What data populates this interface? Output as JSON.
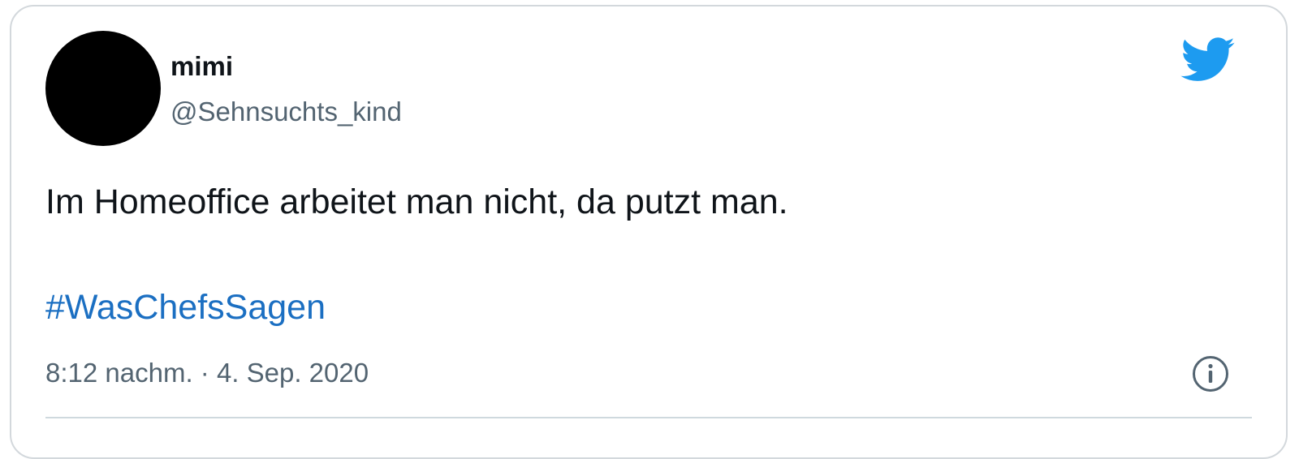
{
  "tweet": {
    "author_name": "mimi",
    "author_handle": "@Sehnsuchts_kind",
    "text": "Im Homeoffice arbeitet man nicht, da putzt man.",
    "hashtag": "#WasChefsSagen",
    "timestamp": "8:12 nachm. · 4. Sep. 2020"
  },
  "icons": {
    "logo": "twitter-bird-icon",
    "info": "info-icon"
  },
  "colors": {
    "brand_blue": "#1d9bf0",
    "link_blue": "#1b6fc2",
    "text_primary": "#0f1419",
    "text_secondary": "#536471",
    "avatar": "#000000"
  }
}
